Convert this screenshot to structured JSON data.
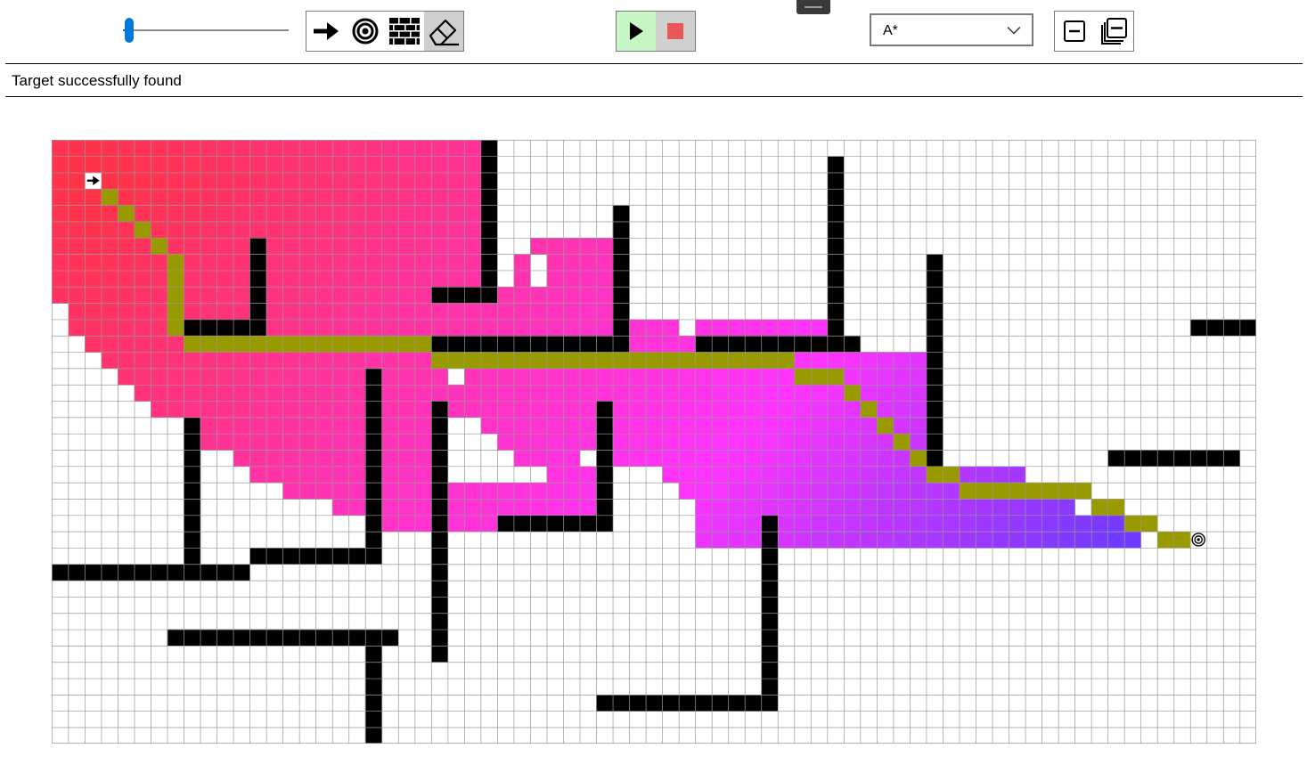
{
  "toolbar": {
    "speed": 0.04,
    "tools": [
      {
        "name": "start-tool",
        "icon": "arrow-right-icon",
        "active": false
      },
      {
        "name": "target-tool",
        "icon": "target-icon",
        "active": false
      },
      {
        "name": "wall-tool",
        "icon": "brick-wall-icon",
        "active": false
      },
      {
        "name": "eraser-tool",
        "icon": "eraser-icon",
        "active": true
      }
    ],
    "run": {
      "play_icon": "play-icon",
      "stop_icon": "stop-icon",
      "play_color": "#c7f5c3",
      "stop_color": "#d0d0d0",
      "stop_mark_color": "#e8585a"
    },
    "algorithm": {
      "selected": "A*",
      "icon": "chevron-down-icon"
    },
    "view_buttons": [
      {
        "name": "collapse-button",
        "icon": "minus-box-icon"
      },
      {
        "name": "collapse-all-button",
        "icon": "stacked-minus-icon"
      }
    ]
  },
  "status": {
    "text": "Target successfully found"
  },
  "grid": {
    "cols": 73,
    "rows": 37,
    "start": [
      2,
      2
    ],
    "target": [
      69,
      24
    ],
    "colors": {
      "wall": "#000000",
      "path": "#999900",
      "gridline": "#999999",
      "empty": "#ffffff",
      "visited_near": "#ff3344",
      "visited_far": "#ff33ff",
      "visited_end": "#5a3bff"
    },
    "walls": [
      [
        0,
        26,
        11,
        26
      ],
      [
        8,
        17,
        8,
        26
      ],
      [
        12,
        6,
        12,
        11
      ],
      [
        8,
        11,
        12,
        11
      ],
      [
        26,
        0,
        26,
        9
      ],
      [
        23,
        9,
        26,
        9
      ],
      [
        23,
        12,
        34,
        12
      ],
      [
        34,
        4,
        34,
        12
      ],
      [
        39,
        12,
        48,
        12
      ],
      [
        47,
        1,
        47,
        12
      ],
      [
        53,
        7,
        53,
        19
      ],
      [
        69,
        11,
        73,
        11
      ],
      [
        64,
        19,
        71,
        19
      ],
      [
        7,
        30,
        20,
        30
      ],
      [
        19,
        30,
        19,
        37
      ],
      [
        12,
        25,
        19,
        25
      ],
      [
        19,
        14,
        19,
        25
      ],
      [
        23,
        16,
        23,
        31
      ],
      [
        27,
        23,
        33,
        23
      ],
      [
        33,
        16,
        33,
        23
      ],
      [
        43,
        23,
        43,
        34
      ],
      [
        33,
        34,
        43,
        34
      ]
    ],
    "path": [
      [
        3,
        3
      ],
      [
        4,
        4
      ],
      [
        5,
        5
      ],
      [
        6,
        6
      ],
      [
        7,
        7
      ],
      [
        7,
        8
      ],
      [
        7,
        9
      ],
      [
        7,
        10
      ],
      [
        7,
        11
      ],
      [
        8,
        12
      ],
      [
        9,
        12
      ],
      [
        10,
        12
      ],
      [
        11,
        12
      ],
      [
        12,
        12
      ],
      [
        13,
        12
      ],
      [
        14,
        12
      ],
      [
        15,
        12
      ],
      [
        16,
        12
      ],
      [
        17,
        12
      ],
      [
        18,
        12
      ],
      [
        19,
        12
      ],
      [
        20,
        12
      ],
      [
        21,
        12
      ],
      [
        22,
        12
      ],
      [
        23,
        13
      ],
      [
        24,
        13
      ],
      [
        25,
        13
      ],
      [
        26,
        13
      ],
      [
        27,
        13
      ],
      [
        28,
        13
      ],
      [
        29,
        13
      ],
      [
        30,
        13
      ],
      [
        31,
        13
      ],
      [
        32,
        13
      ],
      [
        33,
        13
      ],
      [
        34,
        13
      ],
      [
        35,
        13
      ],
      [
        36,
        13
      ],
      [
        37,
        13
      ],
      [
        38,
        13
      ],
      [
        39,
        13
      ],
      [
        40,
        13
      ],
      [
        41,
        13
      ],
      [
        42,
        13
      ],
      [
        43,
        13
      ],
      [
        44,
        13
      ],
      [
        45,
        14
      ],
      [
        46,
        14
      ],
      [
        47,
        14
      ],
      [
        48,
        15
      ],
      [
        49,
        16
      ],
      [
        50,
        17
      ],
      [
        51,
        18
      ],
      [
        52,
        19
      ],
      [
        53,
        20
      ],
      [
        54,
        20
      ],
      [
        55,
        21
      ],
      [
        56,
        21
      ],
      [
        57,
        21
      ],
      [
        58,
        21
      ],
      [
        59,
        21
      ],
      [
        60,
        21
      ],
      [
        61,
        21
      ],
      [
        62,
        21
      ],
      [
        63,
        22
      ],
      [
        64,
        22
      ],
      [
        65,
        23
      ],
      [
        66,
        23
      ],
      [
        67,
        24
      ],
      [
        68,
        24
      ]
    ],
    "visited_spans": [
      [
        0,
        0,
        26,
        26
      ],
      [
        1,
        0,
        26,
        26
      ],
      [
        2,
        0,
        26,
        26
      ],
      [
        3,
        0,
        26,
        26
      ],
      [
        4,
        0,
        26,
        26
      ],
      [
        5,
        0,
        26,
        26
      ],
      [
        6,
        0,
        34,
        29
      ],
      [
        7,
        0,
        34,
        28
      ],
      [
        8,
        0,
        34,
        26
      ],
      [
        9,
        0,
        34,
        22
      ],
      [
        10,
        1,
        34,
        22
      ],
      [
        11,
        1,
        47,
        24
      ],
      [
        12,
        2,
        47,
        26
      ],
      [
        13,
        3,
        52,
        28
      ],
      [
        14,
        4,
        52,
        31
      ],
      [
        15,
        5,
        52,
        33
      ],
      [
        16,
        6,
        52,
        35
      ],
      [
        17,
        8,
        52,
        37
      ],
      [
        18,
        9,
        52,
        39
      ],
      [
        19,
        11,
        52,
        41
      ],
      [
        20,
        12,
        58,
        43
      ],
      [
        21,
        14,
        60,
        44
      ],
      [
        22,
        17,
        61,
        45
      ],
      [
        23,
        20,
        66,
        46
      ],
      [
        24,
        39,
        65,
        47
      ]
    ],
    "unvisited_spans": [
      [
        6,
        27,
        28
      ],
      [
        7,
        27,
        27
      ],
      [
        7,
        29,
        29
      ],
      [
        8,
        27,
        27
      ],
      [
        8,
        29,
        29
      ],
      [
        11,
        38,
        38
      ],
      [
        13,
        24,
        24
      ],
      [
        14,
        24,
        24
      ],
      [
        17,
        23,
        23
      ],
      [
        17,
        24,
        25
      ],
      [
        18,
        23,
        23
      ],
      [
        18,
        24,
        26
      ],
      [
        19,
        19,
        19
      ],
      [
        19,
        23,
        23
      ],
      [
        19,
        24,
        27
      ],
      [
        19,
        32,
        32
      ],
      [
        20,
        23,
        23
      ],
      [
        20,
        24,
        29
      ],
      [
        20,
        33,
        33
      ],
      [
        20,
        34,
        36
      ],
      [
        21,
        33,
        33
      ],
      [
        21,
        34,
        37
      ],
      [
        22,
        33,
        33
      ],
      [
        22,
        34,
        38
      ],
      [
        23,
        33,
        38
      ]
    ]
  }
}
